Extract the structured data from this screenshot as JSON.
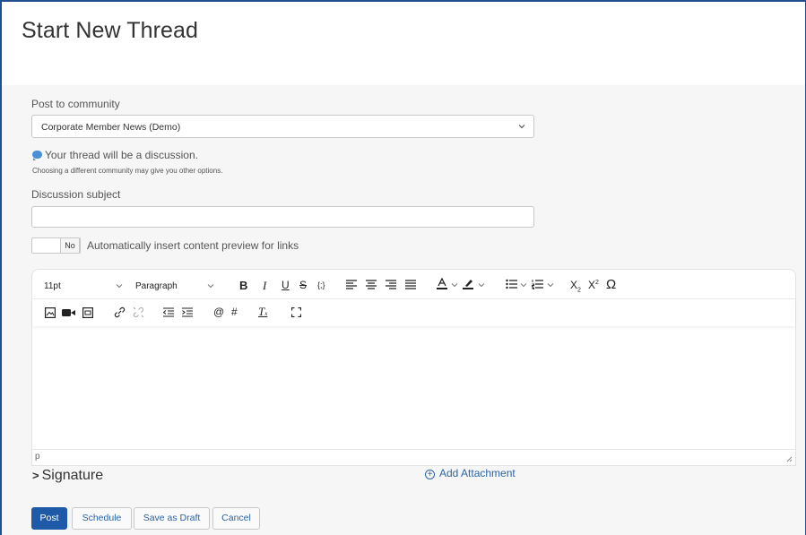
{
  "page": {
    "title": "Start New Thread"
  },
  "community": {
    "label": "Post to community",
    "selected": "Corporate Member News (Demo)",
    "note": "Your thread will be a discussion.",
    "subnote": "Choosing a different community may give you other options."
  },
  "subject": {
    "label": "Discussion subject",
    "value": ""
  },
  "preview_toggle": {
    "state": "No",
    "label": "Automatically insert content preview for links"
  },
  "editor": {
    "font_size": "11pt",
    "block_format": "Paragraph",
    "status_path": "p",
    "toolbar_row1": [
      "bold",
      "italic",
      "underline",
      "strikethrough",
      "code",
      "align-left",
      "align-center",
      "align-right",
      "align-justify",
      "text-color",
      "highlight-color",
      "bullet-list",
      "numbered-list",
      "subscript",
      "superscript",
      "special-character"
    ],
    "toolbar_row2": [
      "image",
      "video",
      "media",
      "link",
      "unlink",
      "outdent",
      "indent",
      "mention",
      "hashtag",
      "clear-formatting",
      "fullscreen"
    ]
  },
  "signature": {
    "label": "Signature"
  },
  "attachment": {
    "label": "Add Attachment"
  },
  "actions": {
    "post": "Post",
    "schedule": "Schedule",
    "save_draft": "Save as Draft",
    "cancel": "Cancel"
  },
  "colors": {
    "primary": "#1e5aa8",
    "link": "#2c64a6",
    "frame": "#1f4f8f",
    "info": "#4a90d9"
  }
}
